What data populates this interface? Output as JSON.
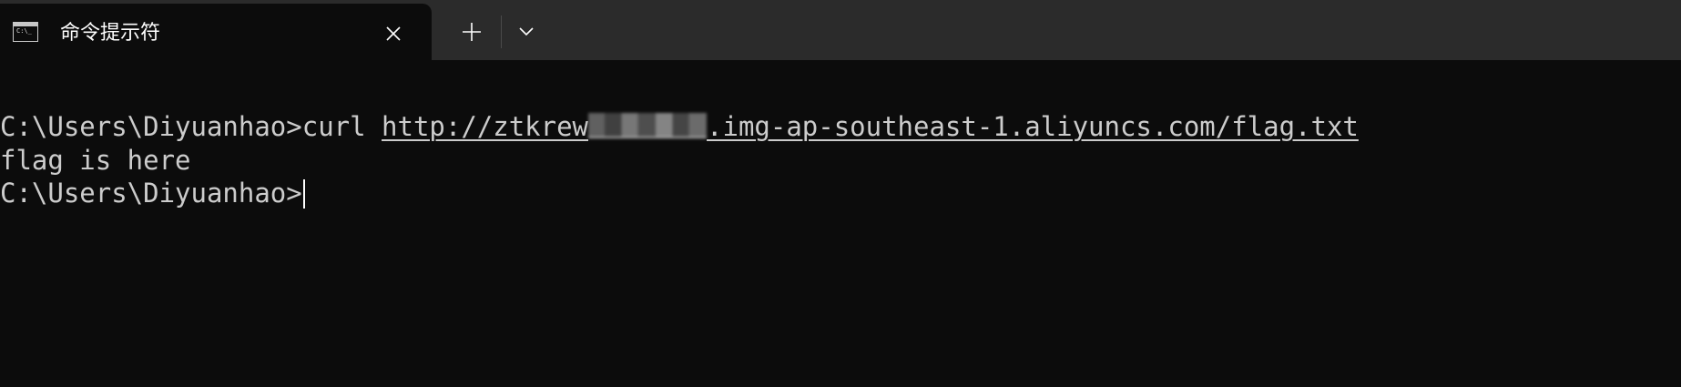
{
  "tab": {
    "title": "命令提示符",
    "icon": "command-prompt-icon",
    "icon_text": "C:\\_"
  },
  "tabbar": {
    "close_icon": "close-icon",
    "new_tab_icon": "plus-icon",
    "dropdown_icon": "chevron-down-icon"
  },
  "terminal": {
    "line1": {
      "prompt": "C:\\Users\\Diyuanhao>",
      "command": "curl ",
      "url_prefix": "http://ztkrew",
      "url_suffix": ".img-ap-southeast-1.aliyuncs.com/flag.txt"
    },
    "line2": "flag is here",
    "line3": {
      "prompt": "C:\\Users\\Diyuanhao>"
    }
  },
  "colors": {
    "background": "#0c0c0c",
    "tabbar": "#2b2b2b",
    "text": "#cccccc",
    "tab_title": "#ffffff"
  }
}
